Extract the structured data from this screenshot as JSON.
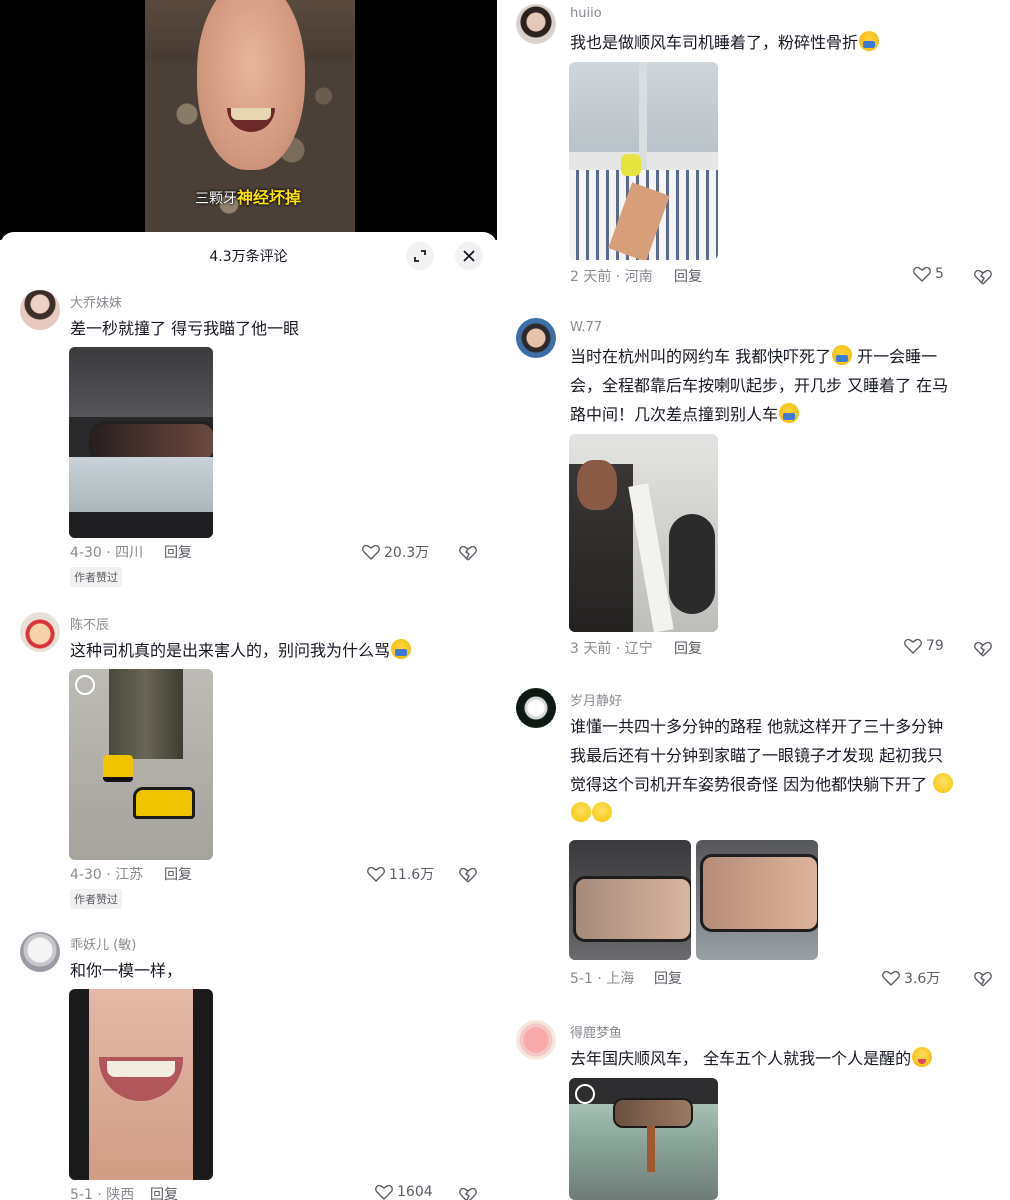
{
  "video": {
    "subtitle_prefix": "三颗牙",
    "subtitle_highlight": "神经坏掉"
  },
  "sheet": {
    "title": "4.3万条评论",
    "expand_icon": "expand-icon",
    "close_icon": "close-icon"
  },
  "left_comments": [
    {
      "name": "大乔妹妹",
      "text": "差一秒就撞了 得亏我瞄了他一眼",
      "time": "4-30 · 四川",
      "reply": "回复",
      "likes": "20.3万",
      "badge": "作者赞过"
    },
    {
      "name": "陈不辰",
      "text": "这种司机真的是出来害人的，别问我为什么骂",
      "time": "4-30 · 江苏",
      "reply": "回复",
      "likes": "11.6万",
      "badge": "作者赞过"
    },
    {
      "name": "乖妖儿 (敏)",
      "text": "和你一模一样，",
      "time": "5-1 · 陕西",
      "reply": "回复",
      "likes": "1604"
    }
  ],
  "right_comments": [
    {
      "name": "huiio",
      "text": "我也是做顺风车司机睡着了，粉碎性骨折",
      "time": "2 天前 · 河南",
      "reply": "回复",
      "likes": "5"
    },
    {
      "name": "W.77",
      "text_lines": [
        "当时在杭州叫的网约车 我都快吓死了",
        " 开一会睡一",
        "会，全程都靠后车按喇叭起步，开几步 又睡着了 在马",
        "路中间！几次差点撞到别人车"
      ],
      "time": "3 天前 · 辽宁",
      "reply": "回复",
      "likes": "79"
    },
    {
      "name": "岁月静好",
      "text_lines": [
        "谁懂一共四十多分钟的路程 他就这样开了三十多分钟",
        "我最后还有十分钟到家瞄了一眼镜子才发现 起初我只",
        "觉得这个司机开车姿势很奇怪 因为他都快躺下开了"
      ],
      "time": "5-1 · 上海",
      "reply": "回复",
      "likes": "3.6万"
    },
    {
      "name": "得鹿梦鱼",
      "text": "去年国庆顺风车， 全车五个人就我一个人是醒的"
    }
  ],
  "colors": {
    "text_primary": "#161823",
    "text_secondary": "#8a8b91",
    "subtitle_highlight": "#ffe100",
    "badge_bg": "#f1f1f2"
  }
}
